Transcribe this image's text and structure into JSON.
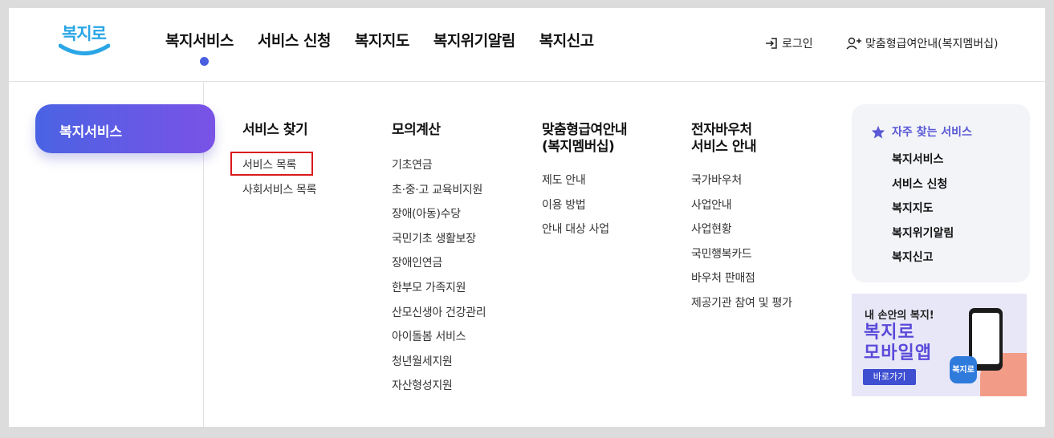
{
  "header": {
    "logo_text": "복지로",
    "nav": [
      "복지서비스",
      "서비스 신청",
      "복지지도",
      "복지위기알림",
      "복지신고"
    ],
    "active_nav": "복지서비스",
    "login": "로그인",
    "membership": "맞춤형급여안내(복지멤버십)"
  },
  "sidebar": {
    "active": "복지서비스"
  },
  "columns": [
    {
      "title": "서비스 찾기",
      "items": [
        "서비스 목록",
        "사회서비스 목록"
      ]
    },
    {
      "title": "모의계산",
      "items": [
        "기초연금",
        "초·중·고 교육비지원",
        "장애(아동)수당",
        "국민기초 생활보장",
        "장애인연금",
        "한부모 가족지원",
        "산모신생아 건강관리",
        "아이돌봄 서비스",
        "청년월세지원",
        "자산형성지원"
      ]
    },
    {
      "title": "맞춤형급여안내\n(복지멤버십)",
      "items": [
        "제도 안내",
        "이용 방법",
        "안내 대상 사업"
      ]
    },
    {
      "title": "전자바우처\n서비스 안내",
      "items": [
        "국가바우처",
        "사업안내",
        "사업현황",
        "국민행복카드",
        "바우처 판매점",
        "제공기관 참여 및 평가"
      ]
    }
  ],
  "favorites": {
    "title": "자주 찾는 서비스",
    "items": [
      "복지서비스",
      "서비스 신청",
      "복지지도",
      "복지위기알림",
      "복지신고"
    ]
  },
  "banner": {
    "line1": "내 손안의 복지!",
    "line2": "복지로\n모바일앱",
    "button": "바로가기",
    "icon_text": "복지로"
  },
  "colors": {
    "accent": "#4a5ee0",
    "favorite_title": "#5a58d6",
    "highlight_box": "#d9191c"
  }
}
